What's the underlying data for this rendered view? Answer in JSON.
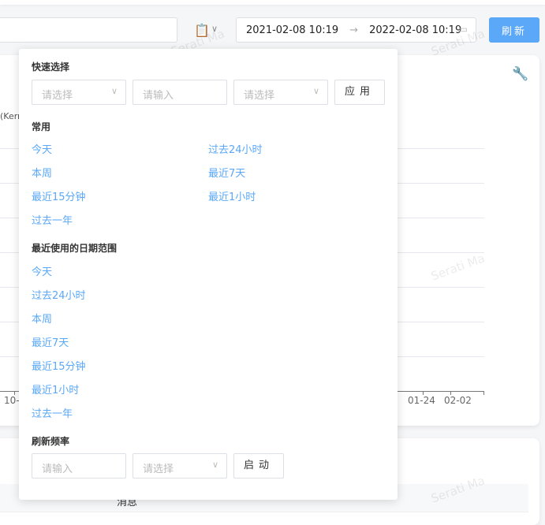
{
  "toolbar": {
    "range_start": "2021-02-08 10:19",
    "range_end": "2022-02-08 10:19",
    "range_sep": "→",
    "refresh": "刷新"
  },
  "chart": {
    "legend_fragment": "(Kern",
    "x_ticks": [
      "10-",
      "01-24",
      "02-02"
    ]
  },
  "table": {
    "header_fragment": "消息"
  },
  "watermark": "Serati Ma",
  "popup": {
    "quick_title": "快速选择",
    "quick_select1": "请选择",
    "quick_input": "请输入",
    "quick_select2": "请选择",
    "apply": "应用",
    "common_title": "常用",
    "common": [
      "今天",
      "过去24小时",
      "本周",
      "最近7天",
      "最近15分钟",
      "最近1小时",
      "过去一年"
    ],
    "recent_title": "最近使用的日期范围",
    "recent": [
      "今天",
      "过去24小时",
      "本周",
      "最近7天",
      "最近15分钟",
      "最近1小时",
      "过去一年"
    ],
    "refresh_title": "刷新频率",
    "refresh_input": "请输入",
    "refresh_select": "请选择",
    "start": "启动"
  }
}
